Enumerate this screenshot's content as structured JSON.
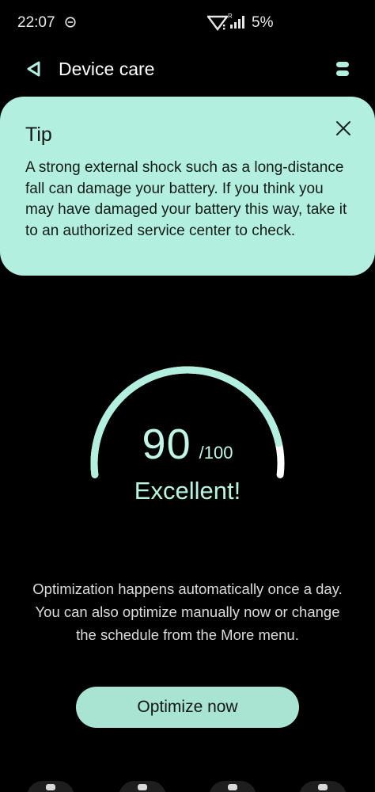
{
  "status_bar": {
    "time": "22:07",
    "battery": "5%",
    "icons": [
      "do-not-disturb-icon",
      "wifi-icon",
      "signal-roaming-icon"
    ]
  },
  "app_bar": {
    "title": "Device care",
    "back_icon": "back-triangle-icon",
    "more_icon": "more-options-icon"
  },
  "tip": {
    "title": "Tip",
    "body": "A strong external shock such as a long-distance fall can damage your battery. If you think you may have damaged your battery this way, take it to an authorized service center to check.",
    "close_icon": "close-icon"
  },
  "score": {
    "value": "90",
    "max": "/100",
    "fraction": 0.9,
    "label": "Excellent!"
  },
  "info": {
    "text": "Optimization happens automatically once a day. You can also optimize manually now or change the schedule from the More menu."
  },
  "actions": {
    "optimize_label": "Optimize now"
  },
  "colors": {
    "accent": "#b2efde",
    "gauge_track": "#ffffff",
    "gauge_fill": "#b2efde",
    "background": "#000000"
  }
}
